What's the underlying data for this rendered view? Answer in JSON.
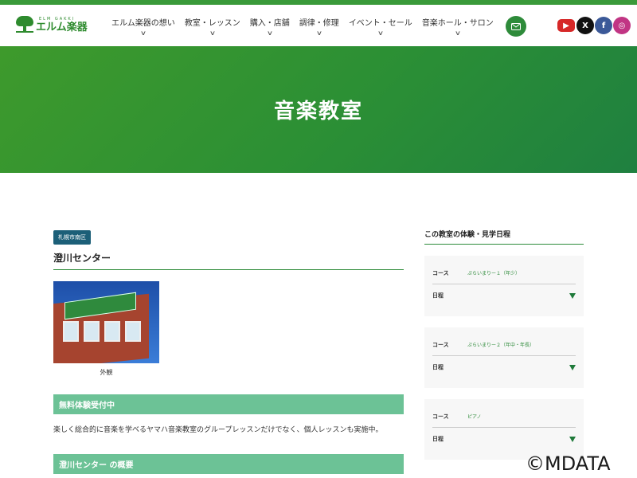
{
  "brand": {
    "name": "エルム楽器",
    "sub": "ELM GAKKI",
    "accent": "#2e8b3a"
  },
  "nav": [
    {
      "label": "エルム楽器の想い"
    },
    {
      "label": "教室・レッスン"
    },
    {
      "label": "購入・店舗"
    },
    {
      "label": "調律・修理"
    },
    {
      "label": "イベント・セール"
    },
    {
      "label": "音楽ホール・サロン"
    }
  ],
  "social": {
    "youtube": "▶",
    "x": "X",
    "facebook": "f",
    "instagram": "◎"
  },
  "hero": {
    "title": "音楽教室"
  },
  "main": {
    "area_tag": "札幌市南区",
    "center_name": "澄川センター",
    "photo_caption": "外観",
    "section1_title": "無料体験受付中",
    "section1_text": "楽しく総合的に音楽を学べるヤマハ音楽教室のグループレッスンだけでなく、個人レッスンも実施中。",
    "section2_title": "澄川センター の概要"
  },
  "sidebar": {
    "title": "この教室の体験・見学日程",
    "course_label": "コース",
    "schedule_label": "日程",
    "courses": [
      {
        "name": "ぷらいまりー１（年少）"
      },
      {
        "name": "ぷらいまりー２（年中・年長）"
      },
      {
        "name": "ピアノ"
      }
    ]
  },
  "watermark": "©MDATA"
}
